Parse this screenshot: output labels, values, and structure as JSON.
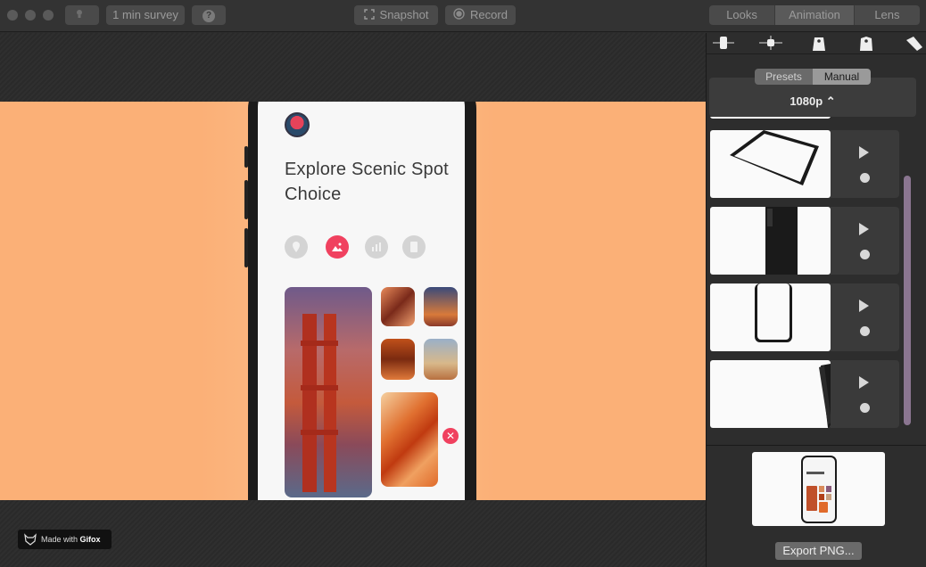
{
  "toolbar": {
    "survey_label": "1 min survey",
    "help_label": "?",
    "snapshot_label": "Snapshot",
    "record_label": "Record",
    "tabs": [
      {
        "label": "Looks"
      },
      {
        "label": "Animation"
      },
      {
        "label": "Lens"
      }
    ]
  },
  "phone_app": {
    "title": "Explore Scenic Spot Choice"
  },
  "watermark": {
    "prefix": "Made with",
    "brand": "Gifox"
  },
  "panel": {
    "presets_label": "Presets",
    "manual_label": "Manual",
    "resolution": "1080p ⌃",
    "export_label": "Export PNG..."
  }
}
